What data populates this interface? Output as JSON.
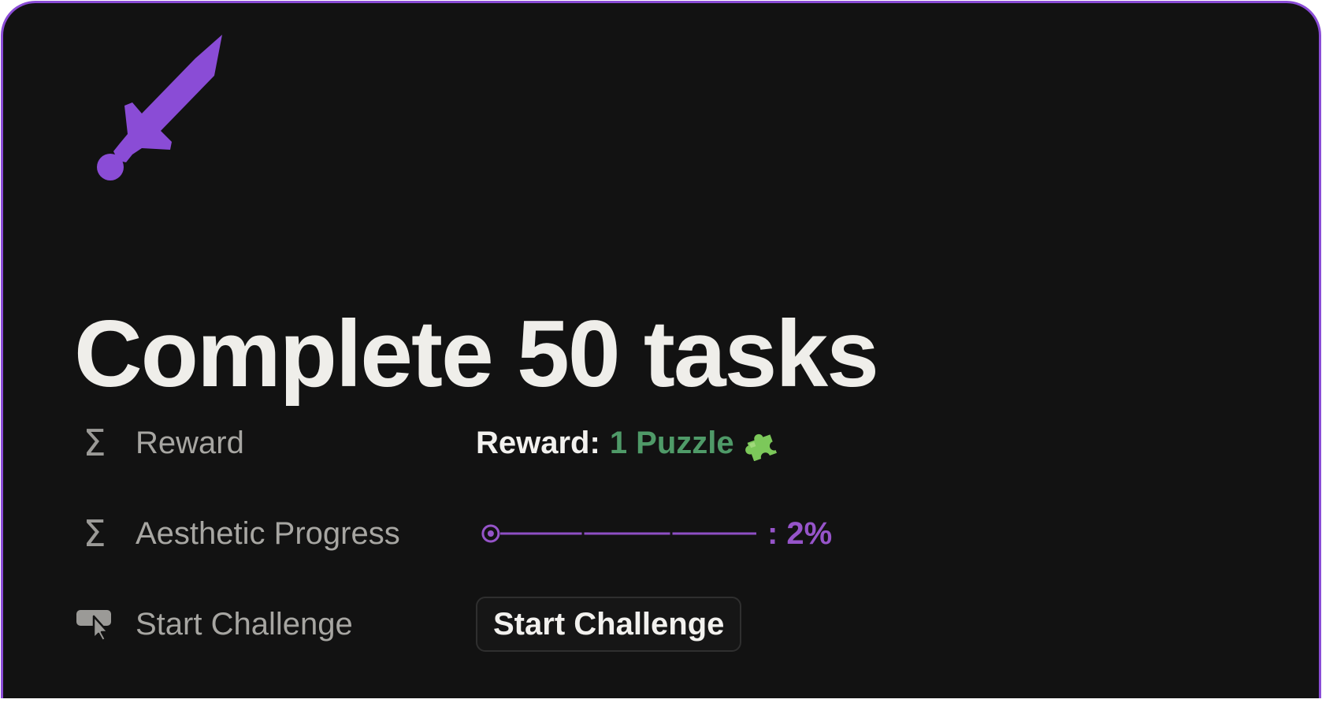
{
  "page": {
    "icon": "sword-icon",
    "title": "Complete 50 tasks",
    "accent_color": "#8a4cd6",
    "background_color": "#121212"
  },
  "properties": [
    {
      "icon": "sigma-icon",
      "label": "Reward",
      "value_prefix": "Reward:",
      "value_amount": "1 Puzzle",
      "value_icon": "puzzle-piece-icon",
      "value_color": "#4f9a68"
    },
    {
      "icon": "sigma-icon",
      "label": "Aesthetic Progress",
      "progress_fraction": 0.02,
      "progress_text": ": 2%",
      "progress_color": "#9654c9"
    },
    {
      "icon": "button-cursor-icon",
      "label": "Start Challenge",
      "button_label": "Start Challenge"
    }
  ]
}
